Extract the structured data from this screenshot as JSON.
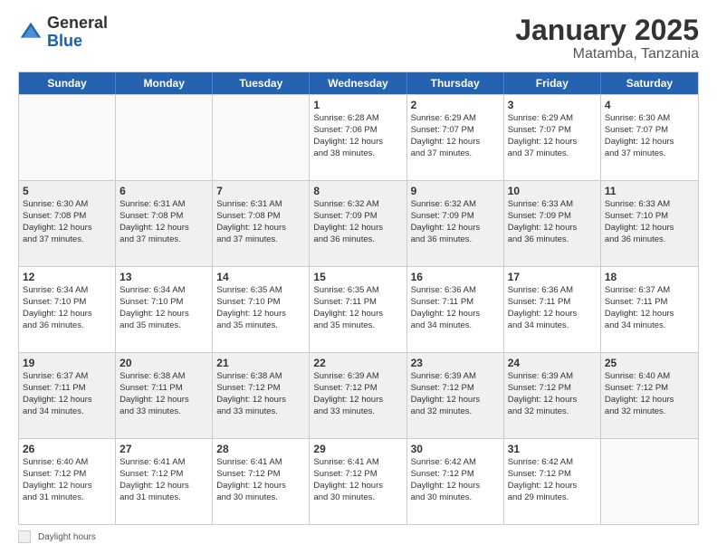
{
  "header": {
    "logo_general": "General",
    "logo_blue": "Blue",
    "month_title": "January 2025",
    "location": "Matamba, Tanzania"
  },
  "days_of_week": [
    "Sunday",
    "Monday",
    "Tuesday",
    "Wednesday",
    "Thursday",
    "Friday",
    "Saturday"
  ],
  "footer": {
    "daylight_label": "Daylight hours"
  },
  "weeks": [
    [
      {
        "day": "",
        "info": "",
        "shaded": false,
        "empty": true
      },
      {
        "day": "",
        "info": "",
        "shaded": false,
        "empty": true
      },
      {
        "day": "",
        "info": "",
        "shaded": false,
        "empty": true
      },
      {
        "day": "1",
        "info": "Sunrise: 6:28 AM\nSunset: 7:06 PM\nDaylight: 12 hours\nand 38 minutes.",
        "shaded": false,
        "empty": false
      },
      {
        "day": "2",
        "info": "Sunrise: 6:29 AM\nSunset: 7:07 PM\nDaylight: 12 hours\nand 37 minutes.",
        "shaded": false,
        "empty": false
      },
      {
        "day": "3",
        "info": "Sunrise: 6:29 AM\nSunset: 7:07 PM\nDaylight: 12 hours\nand 37 minutes.",
        "shaded": false,
        "empty": false
      },
      {
        "day": "4",
        "info": "Sunrise: 6:30 AM\nSunset: 7:07 PM\nDaylight: 12 hours\nand 37 minutes.",
        "shaded": false,
        "empty": false
      }
    ],
    [
      {
        "day": "5",
        "info": "Sunrise: 6:30 AM\nSunset: 7:08 PM\nDaylight: 12 hours\nand 37 minutes.",
        "shaded": true,
        "empty": false
      },
      {
        "day": "6",
        "info": "Sunrise: 6:31 AM\nSunset: 7:08 PM\nDaylight: 12 hours\nand 37 minutes.",
        "shaded": true,
        "empty": false
      },
      {
        "day": "7",
        "info": "Sunrise: 6:31 AM\nSunset: 7:08 PM\nDaylight: 12 hours\nand 37 minutes.",
        "shaded": true,
        "empty": false
      },
      {
        "day": "8",
        "info": "Sunrise: 6:32 AM\nSunset: 7:09 PM\nDaylight: 12 hours\nand 36 minutes.",
        "shaded": true,
        "empty": false
      },
      {
        "day": "9",
        "info": "Sunrise: 6:32 AM\nSunset: 7:09 PM\nDaylight: 12 hours\nand 36 minutes.",
        "shaded": true,
        "empty": false
      },
      {
        "day": "10",
        "info": "Sunrise: 6:33 AM\nSunset: 7:09 PM\nDaylight: 12 hours\nand 36 minutes.",
        "shaded": true,
        "empty": false
      },
      {
        "day": "11",
        "info": "Sunrise: 6:33 AM\nSunset: 7:10 PM\nDaylight: 12 hours\nand 36 minutes.",
        "shaded": true,
        "empty": false
      }
    ],
    [
      {
        "day": "12",
        "info": "Sunrise: 6:34 AM\nSunset: 7:10 PM\nDaylight: 12 hours\nand 36 minutes.",
        "shaded": false,
        "empty": false
      },
      {
        "day": "13",
        "info": "Sunrise: 6:34 AM\nSunset: 7:10 PM\nDaylight: 12 hours\nand 35 minutes.",
        "shaded": false,
        "empty": false
      },
      {
        "day": "14",
        "info": "Sunrise: 6:35 AM\nSunset: 7:10 PM\nDaylight: 12 hours\nand 35 minutes.",
        "shaded": false,
        "empty": false
      },
      {
        "day": "15",
        "info": "Sunrise: 6:35 AM\nSunset: 7:11 PM\nDaylight: 12 hours\nand 35 minutes.",
        "shaded": false,
        "empty": false
      },
      {
        "day": "16",
        "info": "Sunrise: 6:36 AM\nSunset: 7:11 PM\nDaylight: 12 hours\nand 34 minutes.",
        "shaded": false,
        "empty": false
      },
      {
        "day": "17",
        "info": "Sunrise: 6:36 AM\nSunset: 7:11 PM\nDaylight: 12 hours\nand 34 minutes.",
        "shaded": false,
        "empty": false
      },
      {
        "day": "18",
        "info": "Sunrise: 6:37 AM\nSunset: 7:11 PM\nDaylight: 12 hours\nand 34 minutes.",
        "shaded": false,
        "empty": false
      }
    ],
    [
      {
        "day": "19",
        "info": "Sunrise: 6:37 AM\nSunset: 7:11 PM\nDaylight: 12 hours\nand 34 minutes.",
        "shaded": true,
        "empty": false
      },
      {
        "day": "20",
        "info": "Sunrise: 6:38 AM\nSunset: 7:11 PM\nDaylight: 12 hours\nand 33 minutes.",
        "shaded": true,
        "empty": false
      },
      {
        "day": "21",
        "info": "Sunrise: 6:38 AM\nSunset: 7:12 PM\nDaylight: 12 hours\nand 33 minutes.",
        "shaded": true,
        "empty": false
      },
      {
        "day": "22",
        "info": "Sunrise: 6:39 AM\nSunset: 7:12 PM\nDaylight: 12 hours\nand 33 minutes.",
        "shaded": true,
        "empty": false
      },
      {
        "day": "23",
        "info": "Sunrise: 6:39 AM\nSunset: 7:12 PM\nDaylight: 12 hours\nand 32 minutes.",
        "shaded": true,
        "empty": false
      },
      {
        "day": "24",
        "info": "Sunrise: 6:39 AM\nSunset: 7:12 PM\nDaylight: 12 hours\nand 32 minutes.",
        "shaded": true,
        "empty": false
      },
      {
        "day": "25",
        "info": "Sunrise: 6:40 AM\nSunset: 7:12 PM\nDaylight: 12 hours\nand 32 minutes.",
        "shaded": true,
        "empty": false
      }
    ],
    [
      {
        "day": "26",
        "info": "Sunrise: 6:40 AM\nSunset: 7:12 PM\nDaylight: 12 hours\nand 31 minutes.",
        "shaded": false,
        "empty": false
      },
      {
        "day": "27",
        "info": "Sunrise: 6:41 AM\nSunset: 7:12 PM\nDaylight: 12 hours\nand 31 minutes.",
        "shaded": false,
        "empty": false
      },
      {
        "day": "28",
        "info": "Sunrise: 6:41 AM\nSunset: 7:12 PM\nDaylight: 12 hours\nand 30 minutes.",
        "shaded": false,
        "empty": false
      },
      {
        "day": "29",
        "info": "Sunrise: 6:41 AM\nSunset: 7:12 PM\nDaylight: 12 hours\nand 30 minutes.",
        "shaded": false,
        "empty": false
      },
      {
        "day": "30",
        "info": "Sunrise: 6:42 AM\nSunset: 7:12 PM\nDaylight: 12 hours\nand 30 minutes.",
        "shaded": false,
        "empty": false
      },
      {
        "day": "31",
        "info": "Sunrise: 6:42 AM\nSunset: 7:12 PM\nDaylight: 12 hours\nand 29 minutes.",
        "shaded": false,
        "empty": false
      },
      {
        "day": "",
        "info": "",
        "shaded": false,
        "empty": true
      }
    ]
  ]
}
